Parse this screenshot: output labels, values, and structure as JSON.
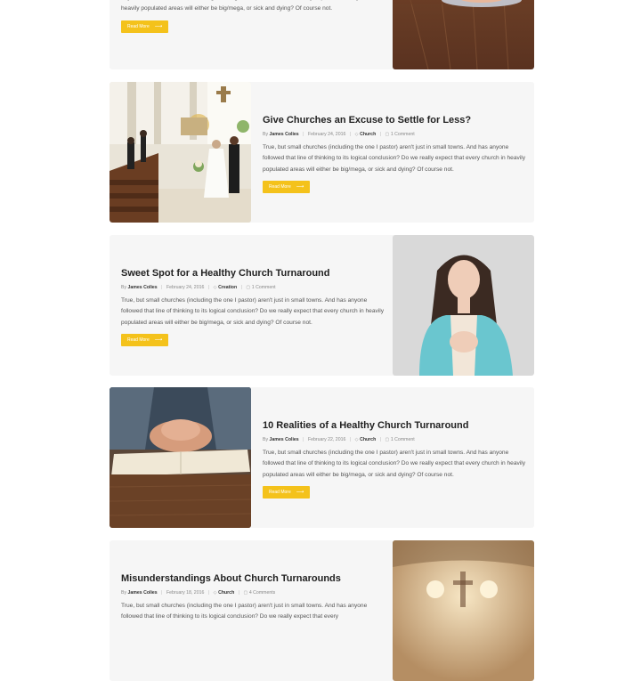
{
  "read_more_label": "Read More",
  "read_more_arrow": "⟶",
  "accent_color": "#f4c21b",
  "posts": [
    {
      "title": "",
      "excerpt_tail": "anyone followed that line of thinking to its logical conclusion? Do we really expect that every church in heavily populated areas will either be big/mega, or sick and dying? Of course not.",
      "image_icon": "hands-on-wooden-table-image"
    },
    {
      "title": "Give Churches an Excuse to Settle for Less?",
      "author_prefix": "By",
      "author": "James Colies",
      "date": "February 24, 2016",
      "category": "Church",
      "comments": "1 Comment",
      "excerpt": "True, but small churches (including the one I pastor) aren't just in small towns. And has anyone followed that line of thinking to its logical conclusion? Do we really expect that every church in heavily populated areas will either be big/mega, or sick and dying? Of course not.",
      "image_icon": "church-wedding-image"
    },
    {
      "title": "Sweet Spot for a Healthy Church Turnaround",
      "author_prefix": "By",
      "author": "James Colies",
      "date": "February 24, 2016",
      "category": "Creation",
      "comments": "1 Comment",
      "excerpt": "True, but small churches (including the one I pastor) aren't just in small towns. And has anyone followed that line of thinking to its logical conclusion? Do we really expect that every church in heavily populated areas will either be big/mega, or sick and dying? Of course not.",
      "image_icon": "praying-woman-image"
    },
    {
      "title": "10 Realities of a Healthy Church Turnaround",
      "author_prefix": "By",
      "author": "James Colies",
      "date": "February 22, 2016",
      "category": "Church",
      "comments": "1 Comment",
      "excerpt": "True, but small churches (including the one I pastor) aren't just in small towns. And has anyone followed that line of thinking to its logical conclusion? Do we really expect that every church in heavily populated areas will either be big/mega, or sick and dying? Of course not.",
      "image_icon": "hands-on-bible-image"
    },
    {
      "title": "Misunderstandings About Church Turnarounds",
      "author_prefix": "By",
      "author": "James Colies",
      "date": "February 18, 2016",
      "category": "Church",
      "comments": "4 Comments",
      "excerpt": "True, but small churches (including the one I pastor) aren't just in small towns. And has anyone followed that line of thinking to its logical conclusion? Do we really expect that every",
      "image_icon": "church-interior-blur-image"
    }
  ]
}
